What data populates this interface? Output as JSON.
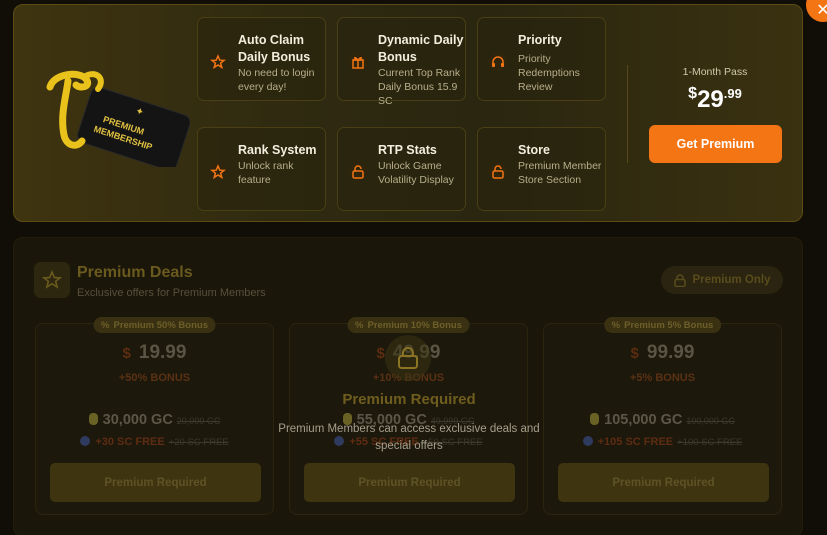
{
  "promo": {
    "card_text": "PREMIUM MEMBERSHIP",
    "features": [
      {
        "icon": "star-icon",
        "title": "Auto Claim Daily Bonus",
        "desc": "No need to login every day!"
      },
      {
        "icon": "gift-icon",
        "title": "Dynamic Daily Bonus",
        "desc": "Current Top Rank Daily Bonus 15.9 SC"
      },
      {
        "icon": "headset-icon",
        "title": "Priority",
        "desc": "Priority Redemptions Review"
      },
      {
        "icon": "star-icon",
        "title": "Rank System",
        "desc": "Unlock rank feature"
      },
      {
        "icon": "lock-icon",
        "title": "RTP Stats",
        "desc": "Unlock Game Volatility Display"
      },
      {
        "icon": "lock-icon",
        "title": "Store",
        "desc": "Premium Member Store Section"
      }
    ],
    "pass_label": "1-Month Pass",
    "price_currency": "$",
    "price_whole": "29",
    "price_cents": ".99",
    "cta_label": "Get Premium",
    "close_label": "✕"
  },
  "deals": {
    "title": "Premium Deals",
    "subtitle": "Exclusive offers for Premium Members",
    "premium_only_label": "Premium Only",
    "items": [
      {
        "badge": "Premium 50% Bonus",
        "currency": "$",
        "price": "19.99",
        "bonus": "+50% BONUS",
        "gc": "30,000 GC",
        "gc_old": "20,000 GC",
        "sc": "+30 SC FREE",
        "sc_old": "+20 SC FREE",
        "button": "Premium Required"
      },
      {
        "badge": "Premium 10% Bonus",
        "currency": "$",
        "price": "49.99",
        "bonus": "+10% BONUS",
        "gc": "55,000 GC",
        "gc_old": "49,999 GC",
        "sc": "+55 SC FREE",
        "sc_old": "+50 SC FREE",
        "button": "Premium Required"
      },
      {
        "badge": "Premium 5% Bonus",
        "currency": "$",
        "price": "99.99",
        "bonus": "+5% BONUS",
        "gc": "105,000 GC",
        "gc_old": "100,000 GC",
        "sc": "+105 SC FREE",
        "sc_old": "+100 SC FREE",
        "button": "Premium Required"
      }
    ],
    "lock_title": "Premium Required",
    "lock_message": "Premium Members can access exclusive deals and special offers"
  },
  "colors": {
    "accent": "#f47514",
    "gold": "#d8b21e"
  }
}
